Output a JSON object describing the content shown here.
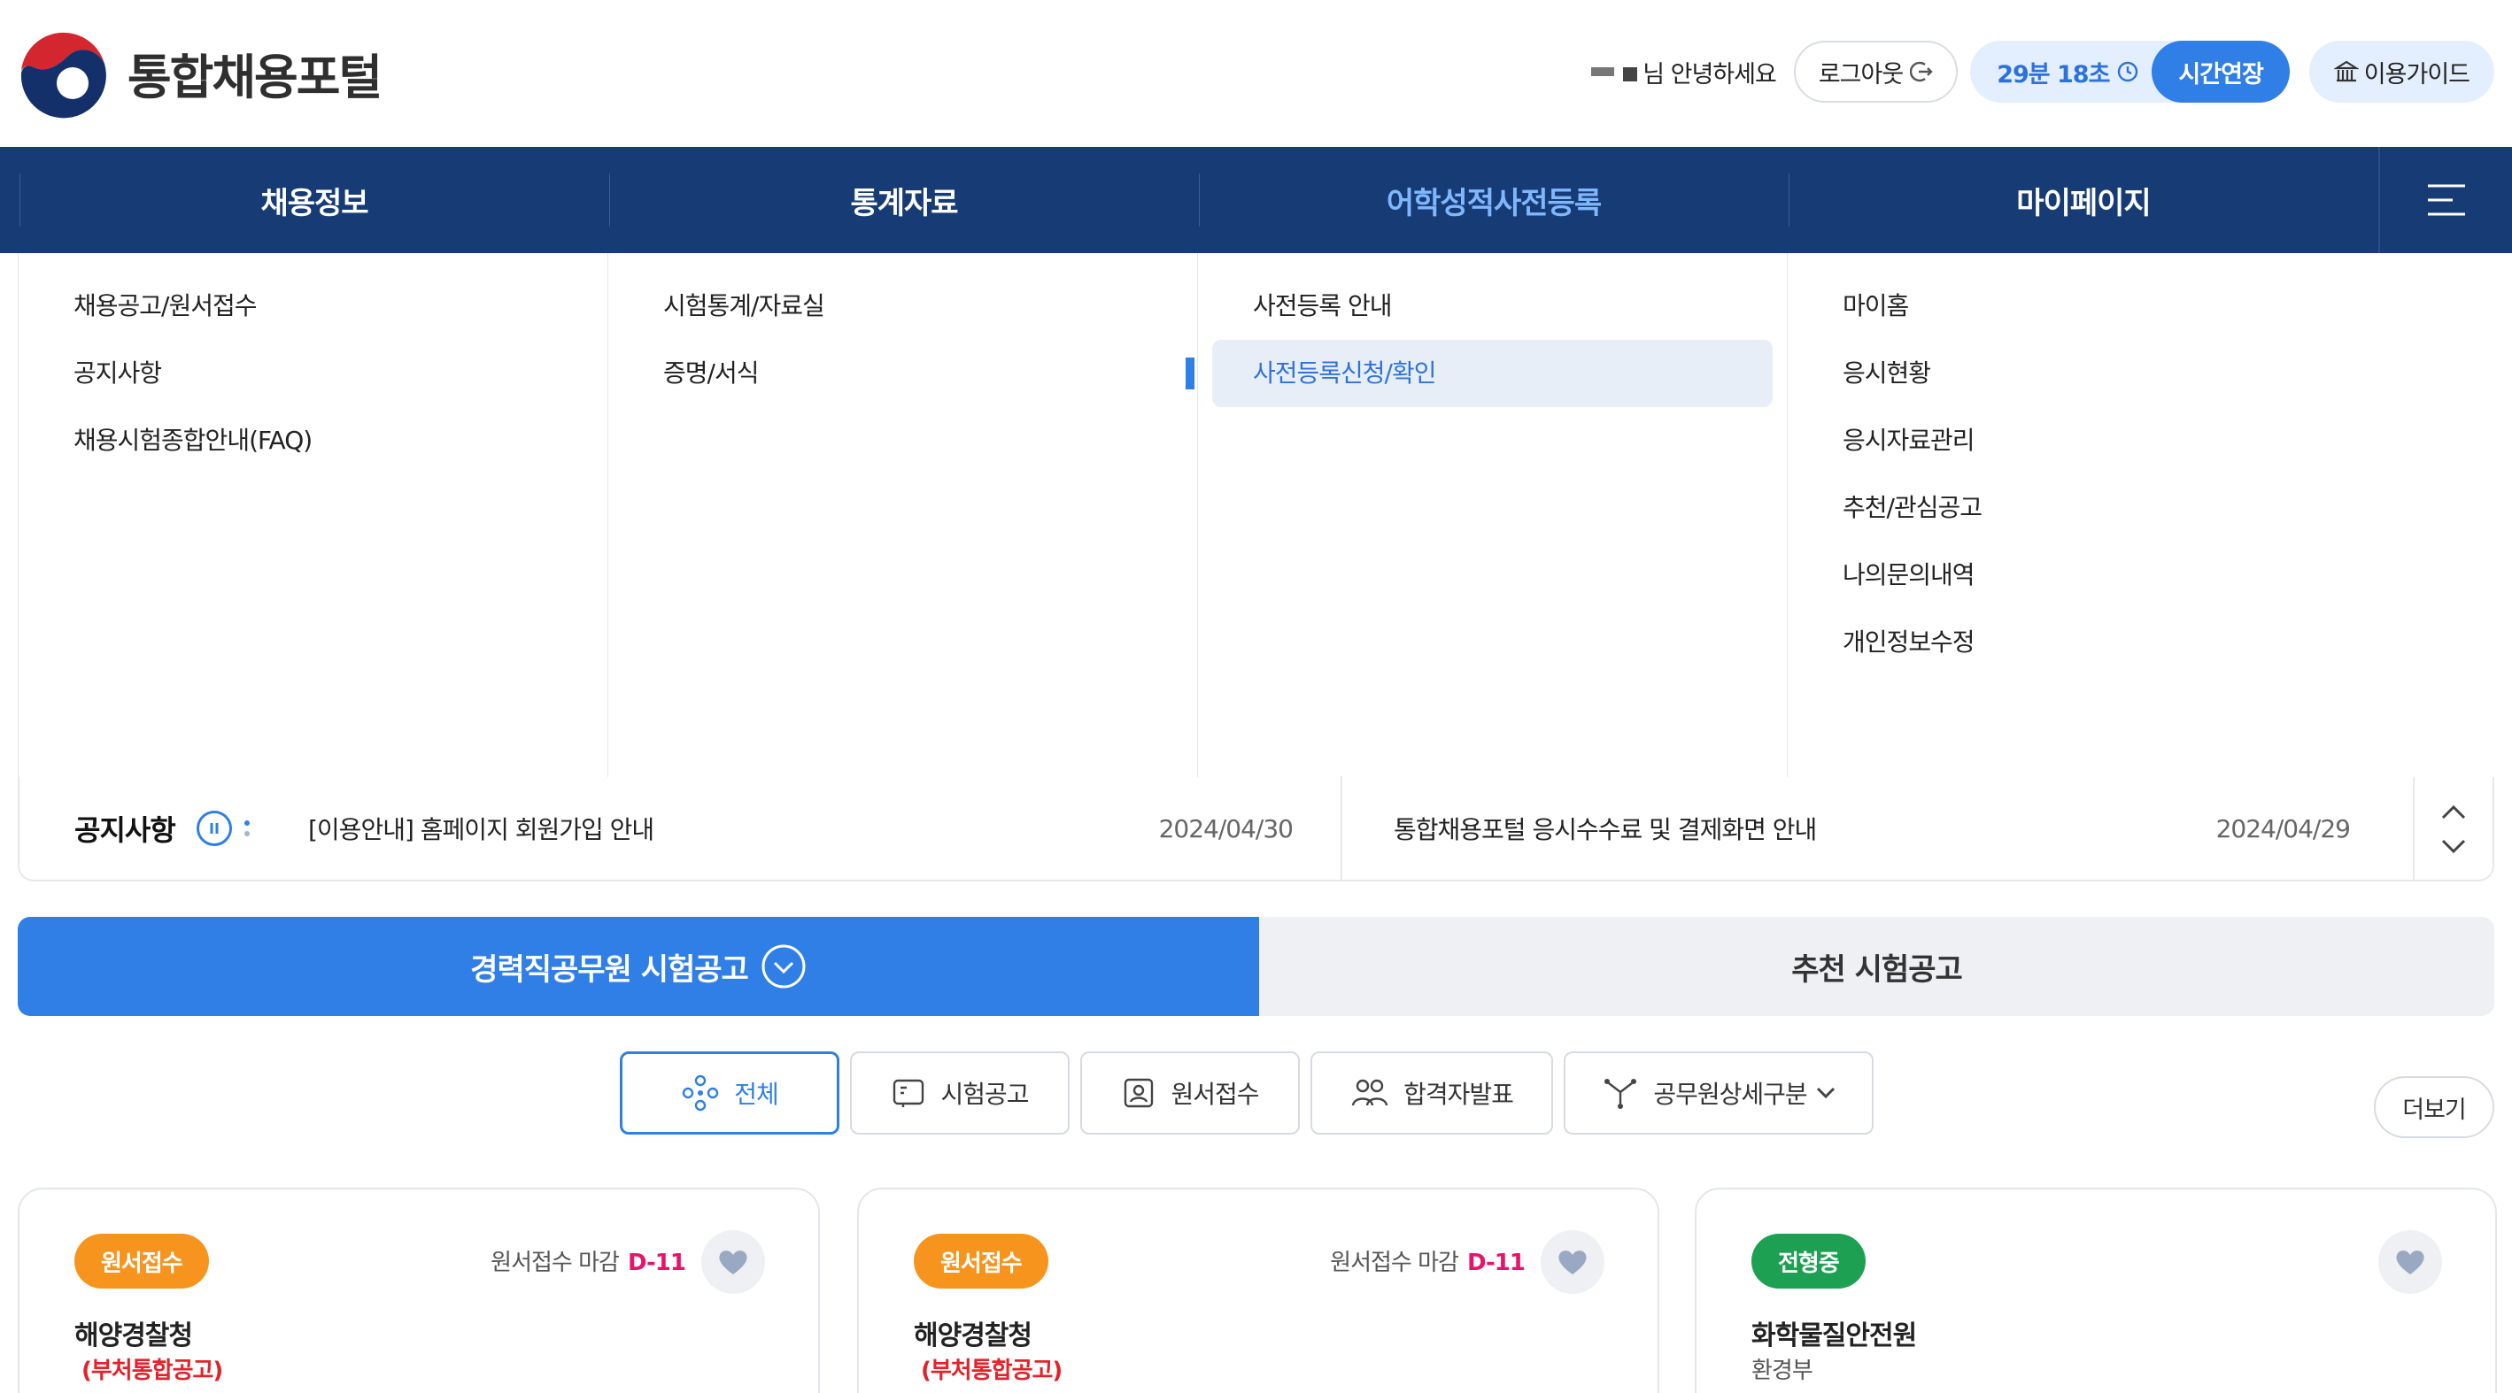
{
  "header": {
    "logo_text": "통합채용포털",
    "greeting": "님 안녕하세요",
    "logout_label": "로그아웃",
    "timer": "29분 18초",
    "extend_label": "시간연장",
    "guide_label": "이용가이드"
  },
  "gnb": {
    "items": [
      "채용정보",
      "통계자료",
      "어학성적사전등록",
      "마이페이지"
    ]
  },
  "mega_menu": {
    "col1": [
      "채용공고/원서접수",
      "공지사항",
      "채용시험종합안내(FAQ)"
    ],
    "col2": [
      "시험통계/자료실",
      "증명/서식"
    ],
    "col3": [
      "사전등록 안내",
      "사전등록신청/확인"
    ],
    "col4": [
      "마이홈",
      "응시현황",
      "응시자료관리",
      "추천/관심공고",
      "나의문의내역",
      "개인정보수정"
    ]
  },
  "notice": {
    "label": "공지사항",
    "items": [
      {
        "title": "[이용안내] 홈페이지 회원가입 안내",
        "date": "2024/04/30"
      },
      {
        "title": "통합채용포털 응시수수료 및 결제화면 안내",
        "date": "2024/04/29"
      }
    ]
  },
  "tabs": {
    "main": "경력직공무원 시험공고",
    "sub": "추천 시험공고"
  },
  "filters": {
    "items": [
      "전체",
      "시험공고",
      "원서접수",
      "합격자발표",
      "공무원상세구분"
    ],
    "more": "더보기"
  },
  "cards": [
    {
      "badge": "원서접수",
      "deadline_label": "원서접수 마감",
      "dday": "D-11",
      "org": "해양경찰청",
      "note": "(부처통합공고)"
    },
    {
      "badge": "원서접수",
      "deadline_label": "원서접수 마감",
      "dday": "D-11",
      "org": "해양경찰청",
      "note": "(부처통합공고)"
    },
    {
      "badge": "전형중",
      "org": "화학물질안전원",
      "dept": "환경부"
    }
  ],
  "colors": {
    "navy": "#173c75",
    "primary_blue": "#2f7fe6",
    "orange_badge": "#f7941d",
    "green_badge": "#1ea052",
    "dday_pink": "#e6156b",
    "note_red": "#e2232a"
  }
}
